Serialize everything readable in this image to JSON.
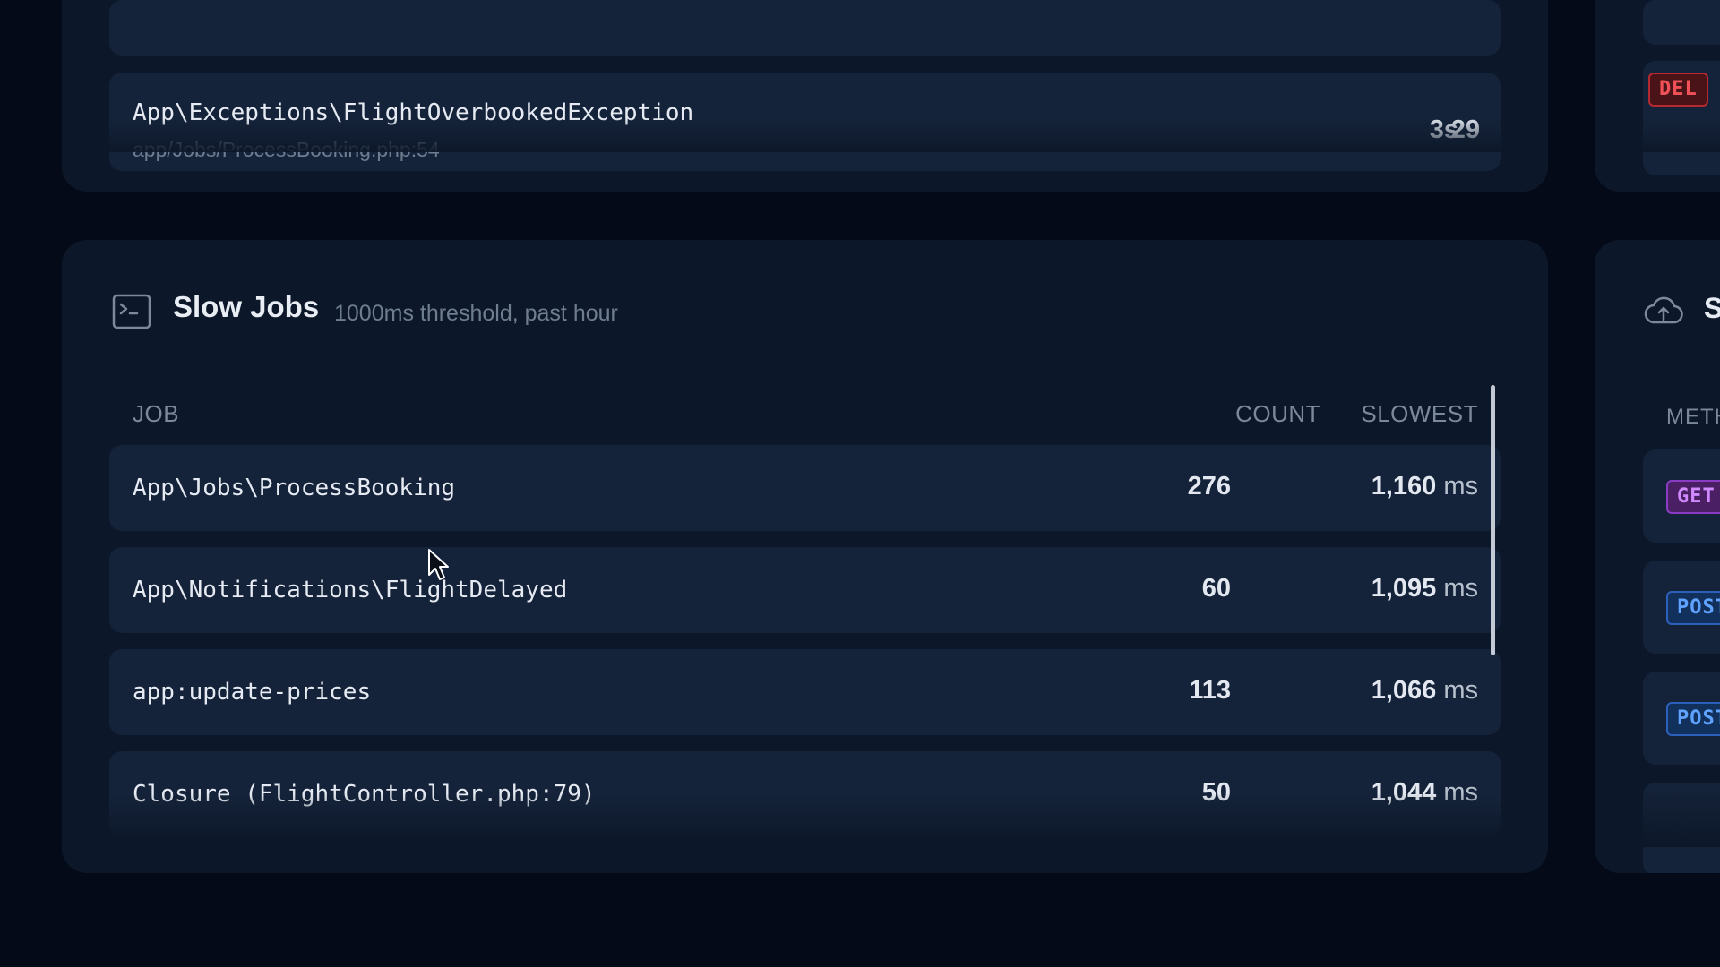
{
  "exceptions": {
    "row": {
      "name": "App\\Exceptions\\FlightOverbookedException",
      "location": "app/Jobs/ProcessBooking.php:54",
      "latest": "3s",
      "count": "29"
    }
  },
  "right_top": {
    "badge": "DEL"
  },
  "slow_jobs": {
    "icon": "terminal-icon",
    "title": "Slow Jobs",
    "subtitle": "1000ms threshold, past hour",
    "columns": {
      "job": "JOB",
      "count": "COUNT",
      "slowest": "SLOWEST"
    },
    "rows": [
      {
        "job": "App\\Jobs\\ProcessBooking",
        "count": "276",
        "slowest": "1,160",
        "unit": "ms"
      },
      {
        "job": "App\\Notifications\\FlightDelayed",
        "count": "60",
        "slowest": "1,095",
        "unit": "ms"
      },
      {
        "job": "app:update-prices",
        "count": "113",
        "slowest": "1,066",
        "unit": "ms"
      },
      {
        "job": "Closure (FlightController.php:79)",
        "count": "50",
        "slowest": "1,044",
        "unit": "ms"
      }
    ]
  },
  "slow_requests": {
    "icon": "cloud-upload-icon",
    "title": "S",
    "column": "METH",
    "badges": [
      "GET",
      "POST",
      "POST"
    ]
  },
  "colors": {
    "background": "#040a17",
    "panel": "#0c1829",
    "row": "#15233a",
    "delete": "#f05257",
    "get": "#d189ff",
    "post": "#5fa2ff"
  }
}
